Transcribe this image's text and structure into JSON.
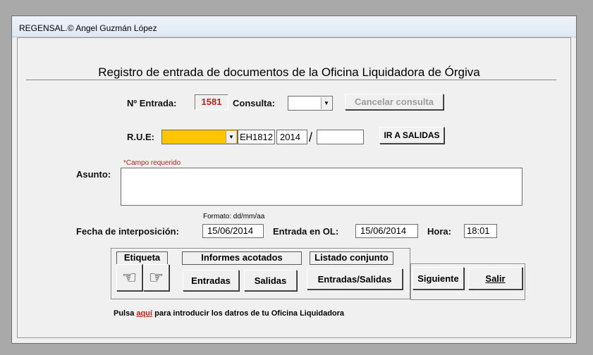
{
  "window": {
    "title": "REGENSAL.© Angel Guzmán López"
  },
  "form": {
    "heading": "Registro de entrada de documentos de la Oficina Liquidadora de Órgiva",
    "entrada_label": "Nº Entrada:",
    "entrada_value": "1581",
    "consulta_label": "Consulta:",
    "consulta_value": "",
    "cancelar_label": "Cancelar consulta",
    "rue_label": "R.U.E:",
    "rue_prefix": "EH1812",
    "rue_year": "2014",
    "rue_slash": "/",
    "rue_number": "",
    "ir_salidas_label": "IR A SALIDAS",
    "required_note": "*Campo requerido",
    "asunto_label": "Asunto:",
    "asunto_value": "",
    "format_hint": "Formato: dd/mm/aa",
    "fecha_label": "Fecha de interposición:",
    "fecha_value": "15/06/2014",
    "entrada_ol_label": "Entrada en OL:",
    "entrada_ol_value": "15/06/2014",
    "hora_label": "Hora:",
    "hora_value": "18:01"
  },
  "actions": {
    "etiqueta_label": "Etiqueta",
    "informes_label": "Informes acotados",
    "listado_label": "Listado conjunto",
    "entradas_btn": "Entradas",
    "salidas_btn": "Salidas",
    "entradas_salidas_btn": "Entradas/Salidas",
    "siguiente_btn": "Siguiente",
    "salir_btn": "Salir",
    "hand_left_icon": "☜",
    "hand_right_icon": "☞"
  },
  "footer": {
    "text_before": "Pulsa",
    "link_text": "aquí",
    "text_after": "para introducir los datros de tu Oficina Liquidadora"
  },
  "colors": {
    "required_red": "#b3261e",
    "combo_highlight": "#ffc600"
  }
}
